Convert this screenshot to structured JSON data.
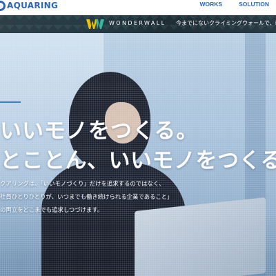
{
  "header": {
    "logo_text": "AQUARING",
    "nav": [
      "WORKS",
      "SOLUTION"
    ]
  },
  "banner": {
    "title": "WONDERWALL",
    "text": "今までにないクライミングウォールで、新し"
  },
  "hero": {
    "headline_1": "いいモノをつくる。",
    "headline_2": "とことん、いいモノをつくる",
    "description": [
      "クアリングは、「いいモノづくり」だけを追求するのではなく、",
      "社員ひとりひとりが、いつまでも働き続けられる企業であること」",
      "の両立をどこまでも追求しつづけます。"
    ]
  },
  "colors": {
    "brand": "#2b66b8",
    "banner_bg": "#253a44",
    "accent": "#3b7fd0"
  },
  "icons": {
    "logo": "aquaring-ring-icon",
    "banner_logo": "wonderwall-w-icon"
  }
}
